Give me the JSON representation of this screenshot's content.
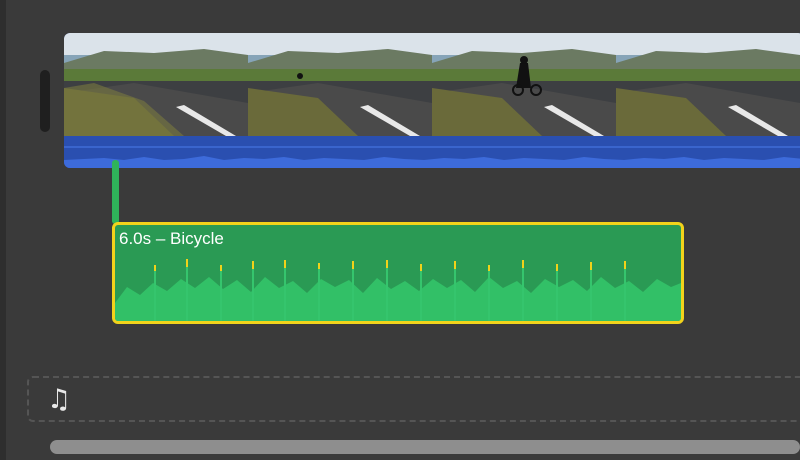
{
  "timeline": {
    "audio_clip": {
      "label": "6.0s – Bicycle",
      "color": "#2a9a54",
      "selected_border_color": "#f2d31b"
    },
    "video_clip": {
      "audio_color": "#2a4fb0",
      "frames": [
        "frame-1",
        "frame-2",
        "frame-3",
        "frame-4"
      ]
    },
    "music_track": {
      "icon": "music-note-icon",
      "glyph": "♫"
    }
  }
}
